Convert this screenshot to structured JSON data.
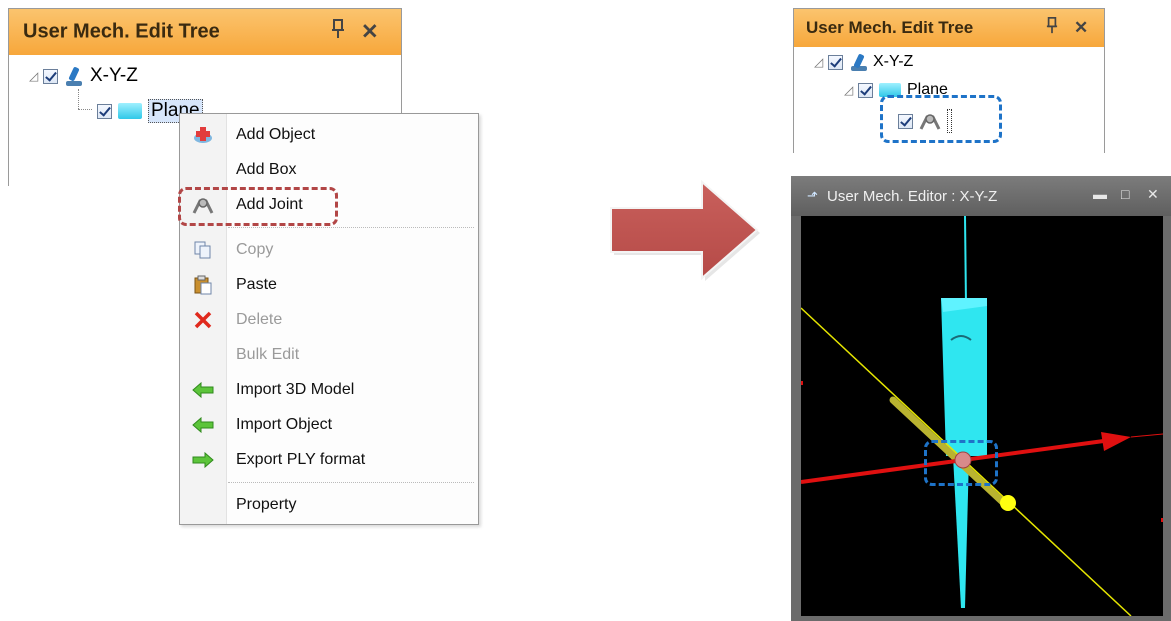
{
  "tree_panel_left": {
    "title": "User Mech. Edit Tree",
    "pin_glyph": "ф",
    "close_glyph": "✕",
    "nodes": [
      {
        "label": "X-Y-Z",
        "icon": "robot-icon"
      },
      {
        "label": "Plane",
        "icon": "folder-icon"
      }
    ]
  },
  "context_menu": {
    "items": [
      {
        "label": "Add Object",
        "icon": "add-object-icon",
        "enabled": true
      },
      {
        "label": "Add Box",
        "icon": "",
        "enabled": true
      },
      {
        "label": "Add Joint",
        "icon": "joint-icon",
        "enabled": true,
        "highlighted": true
      },
      {
        "label": "Copy",
        "icon": "copy-icon",
        "enabled": false
      },
      {
        "label": "Paste",
        "icon": "paste-icon",
        "enabled": true
      },
      {
        "label": "Delete",
        "icon": "delete-icon",
        "enabled": false
      },
      {
        "label": "Bulk Edit",
        "icon": "",
        "enabled": false
      },
      {
        "label": "Import 3D Model",
        "icon": "import-arrow-icon",
        "enabled": true
      },
      {
        "label": "Import Object",
        "icon": "import-arrow-icon",
        "enabled": true
      },
      {
        "label": "Export PLY format",
        "icon": "export-arrow-icon",
        "enabled": true
      },
      {
        "label": "Property",
        "icon": "",
        "enabled": true
      }
    ]
  },
  "tree_panel_right": {
    "title": "User Mech. Edit Tree",
    "pin_glyph": "ф",
    "close_glyph": "✕",
    "nodes": [
      {
        "label": "X-Y-Z",
        "icon": "robot-icon"
      },
      {
        "label": "Plane",
        "icon": "folder-icon"
      },
      {
        "label": "",
        "icon": "joint-icon"
      }
    ]
  },
  "editor_window": {
    "title": "User Mech. Editor : X-Y-Z",
    "minimize_glyph": "▬",
    "maximize_glyph": "□",
    "close_glyph": "✕"
  },
  "colors": {
    "panel_title_bg": "#f7a73b",
    "highlight_red_dash": "#b24646",
    "highlight_blue_dash": "#1e73c8",
    "transition_arrow": "#c0504d",
    "plane_cyan": "#2fe6f0",
    "x_axis_red": "#e01010",
    "line_yellow": "#e6e600"
  }
}
